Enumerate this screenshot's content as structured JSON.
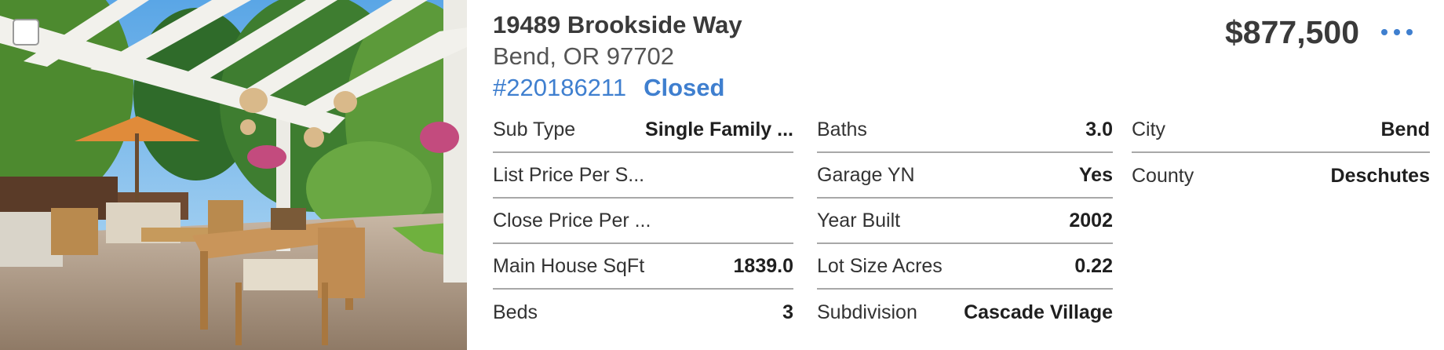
{
  "listing": {
    "address": "19489 Brookside Way",
    "city_state_zip": "Bend, OR 97702",
    "mls_number": "#220186211",
    "status": "Closed",
    "price": "$877,500"
  },
  "colors": {
    "accent": "#3f7fcf",
    "text": "#2b2b2b",
    "divider": "#a8a8a8"
  },
  "photo": {
    "icon": "patio-photo"
  },
  "details": {
    "col1": [
      {
        "label": "Sub Type",
        "value": "Single Family ..."
      },
      {
        "label": "List Price Per S...",
        "value": ""
      },
      {
        "label": "Close Price Per ...",
        "value": ""
      },
      {
        "label": "Main House SqFt",
        "value": "1839.0"
      },
      {
        "label": "Beds",
        "value": "3"
      }
    ],
    "col2": [
      {
        "label": "Baths",
        "value": "3.0"
      },
      {
        "label": "Garage YN",
        "value": "Yes"
      },
      {
        "label": "Year Built",
        "value": "2002"
      },
      {
        "label": "Lot Size Acres",
        "value": "0.22"
      },
      {
        "label": "Subdivision",
        "value": "Cascade Village"
      }
    ],
    "col3": [
      {
        "label": "City",
        "value": "Bend"
      },
      {
        "label": "County",
        "value": "Deschutes"
      }
    ]
  }
}
